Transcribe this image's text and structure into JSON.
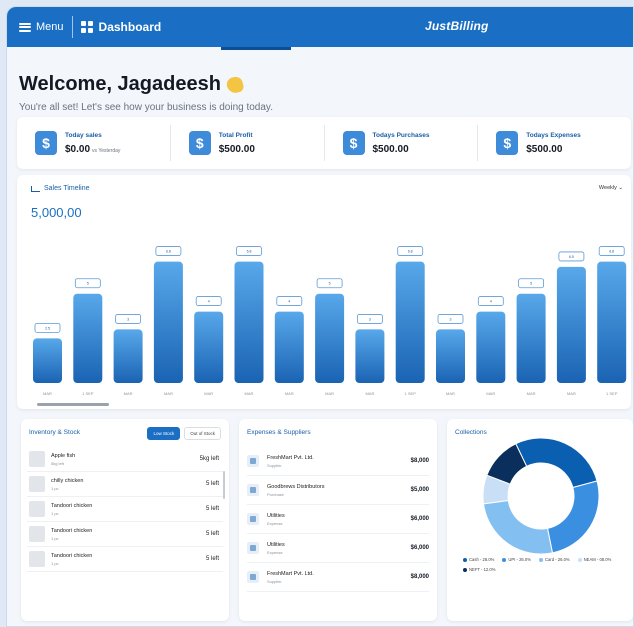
{
  "topbar": {
    "menu_label": "Menu",
    "dashboard_label": "Dashboard",
    "brand": "JustBilling"
  },
  "welcome": {
    "title": "Welcome, Jagadeesh",
    "subtitle": "You're all set! Let's see how your business is doing today."
  },
  "stats": [
    {
      "label": "Today sales",
      "value": "$0.00",
      "note": "vs Yesterday"
    },
    {
      "label": "Total Profit",
      "value": "$500.00",
      "note": ""
    },
    {
      "label": "Todays Purchases",
      "value": "$500.00",
      "note": ""
    },
    {
      "label": "Todays Expenses",
      "value": "$500.00",
      "note": ""
    }
  ],
  "sales": {
    "title": "Sales Timeline",
    "period": "Weekly",
    "total": "5,000,00"
  },
  "chart_data": {
    "type": "bar",
    "title": "Sales Timeline",
    "categories": [
      "MAR",
      "1 SEP",
      "MAR",
      "MAR",
      "MAR",
      "MAR",
      "MAR",
      "MAR",
      "MAR",
      "1 SEP",
      "MAR",
      "MAR",
      "MAR",
      "MAR",
      "1 SEP"
    ],
    "values": [
      2.5,
      5.0,
      3.0,
      6.8,
      4.0,
      6.8,
      4.0,
      5.0,
      3.0,
      6.8,
      3.0,
      4.0,
      5.0,
      6.5,
      6.8
    ],
    "ylim": [
      0,
      7
    ],
    "color_top": "#58a8ea",
    "color_bottom": "#1a63b3"
  },
  "inventory": {
    "title": "Inventory & Stock",
    "tab_low": "Low Stock",
    "tab_out": "Out of Stock",
    "items": [
      {
        "name": "Apple fish",
        "sub": "5kg left",
        "left": "5kg left"
      },
      {
        "name": "chilly chicken",
        "sub": "1 pc",
        "left": "5 left"
      },
      {
        "name": "Tandoori chicken",
        "sub": "1 pc",
        "left": "5 left"
      },
      {
        "name": "Tandoori chicken",
        "sub": "1 pc",
        "left": "5 left"
      },
      {
        "name": "Tandoori chicken",
        "sub": "1 pc",
        "left": "5 left"
      }
    ]
  },
  "expenses": {
    "title": "Expenses & Suppliers",
    "items": [
      {
        "name": "FreshMart Pvt. Ltd.",
        "sub": "Supplier",
        "amount": "$8,000"
      },
      {
        "name": "Goodbrews Distributors",
        "sub": "Purchase",
        "amount": "$5,000"
      },
      {
        "name": "Utilities",
        "sub": "Expense",
        "amount": "$6,000"
      },
      {
        "name": "Utilities",
        "sub": "Expense",
        "amount": "$6,000"
      },
      {
        "name": "FreshMart Pvt. Ltd.",
        "sub": "Supplier",
        "amount": "$8,000"
      }
    ]
  },
  "collections": {
    "title": "Collections",
    "slices": [
      {
        "label": "Cash",
        "value": 28,
        "color": "#0a5fb0"
      },
      {
        "label": "UPI",
        "value": 26,
        "color": "#3a8fe0"
      },
      {
        "label": "Card",
        "value": 26,
        "color": "#83c0f1"
      },
      {
        "label": "NEAM",
        "value": 8,
        "color": "#c8dff5"
      },
      {
        "label": "NEFT",
        "value": 12,
        "color": "#0b2f5c"
      }
    ],
    "legend": [
      "Cash - 28.0%",
      "UPI - 26.0%",
      "Card - 26.0%",
      "NEAM - 08.0%",
      "NEFT - 12.0%"
    ]
  }
}
